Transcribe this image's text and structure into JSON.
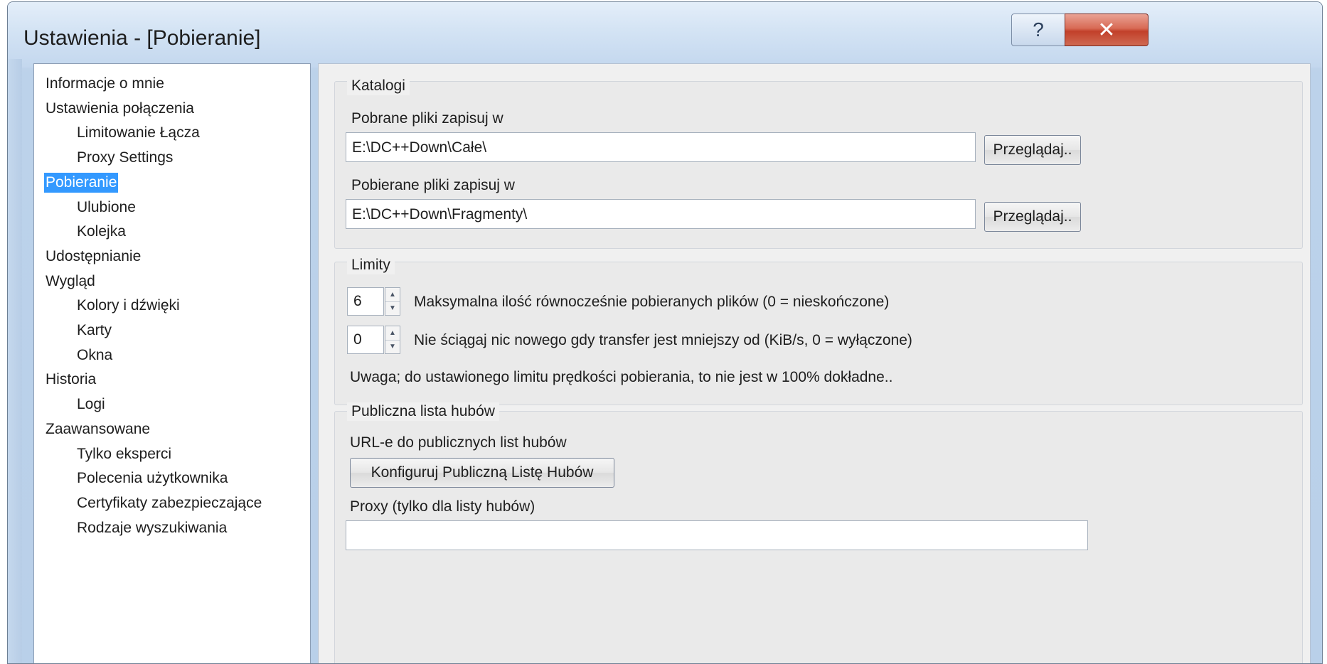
{
  "window": {
    "title": "Ustawienia - [Pobieranie]",
    "help_label": "?",
    "close_label": "✕"
  },
  "sidebar": {
    "items": [
      {
        "label": "Informacje o mnie",
        "level": 0
      },
      {
        "label": "Ustawienia połączenia",
        "level": 0
      },
      {
        "label": "Limitowanie Łącza",
        "level": 1
      },
      {
        "label": "Proxy Settings",
        "level": 1
      },
      {
        "label": "Pobieranie",
        "level": 0,
        "selected": true
      },
      {
        "label": "Ulubione",
        "level": 1
      },
      {
        "label": "Kolejka",
        "level": 1
      },
      {
        "label": "Udostępnianie",
        "level": 0
      },
      {
        "label": "Wygląd",
        "level": 0
      },
      {
        "label": "Kolory i dźwięki",
        "level": 1
      },
      {
        "label": "Karty",
        "level": 1
      },
      {
        "label": "Okna",
        "level": 1
      },
      {
        "label": "Historia",
        "level": 0
      },
      {
        "label": "Logi",
        "level": 1
      },
      {
        "label": "Zaawansowane",
        "level": 0
      },
      {
        "label": "Tylko eksperci",
        "level": 1
      },
      {
        "label": "Polecenia użytkownika",
        "level": 1
      },
      {
        "label": "Certyfikaty zabezpieczające",
        "level": 1
      },
      {
        "label": "Rodzaje wyszukiwania",
        "level": 1
      }
    ]
  },
  "katalogi": {
    "legend": "Katalogi",
    "downloaded_label": "Pobrane pliki zapisuj w",
    "downloaded_value": "E:\\DC++Down\\Całe\\",
    "downloaded_browse": "Przeglądaj..",
    "downloading_label": "Pobierane pliki zapisuj w",
    "downloading_value": "E:\\DC++Down\\Fragmenty\\",
    "downloading_browse": "Przeglądaj.."
  },
  "limity": {
    "legend": "Limity",
    "max_files_value": "6",
    "max_files_label": "Maksymalna ilość równocześnie pobieranych plików (0 = nieskończone)",
    "min_speed_value": "0",
    "min_speed_label": "Nie ściągaj nic nowego gdy transfer jest mniejszy od (KiB/s, 0 = wyłączone)",
    "note": "Uwaga; do ustawionego limitu prędkości pobierania, to nie jest w 100% dokładne.."
  },
  "hublist": {
    "legend": "Publiczna lista hubów",
    "urls_label": "URL-e do publicznych list hubów",
    "configure_button": "Konfiguruj Publiczną Listę Hubów",
    "proxy_label": "Proxy (tylko dla listy hubów)",
    "proxy_value": ""
  }
}
